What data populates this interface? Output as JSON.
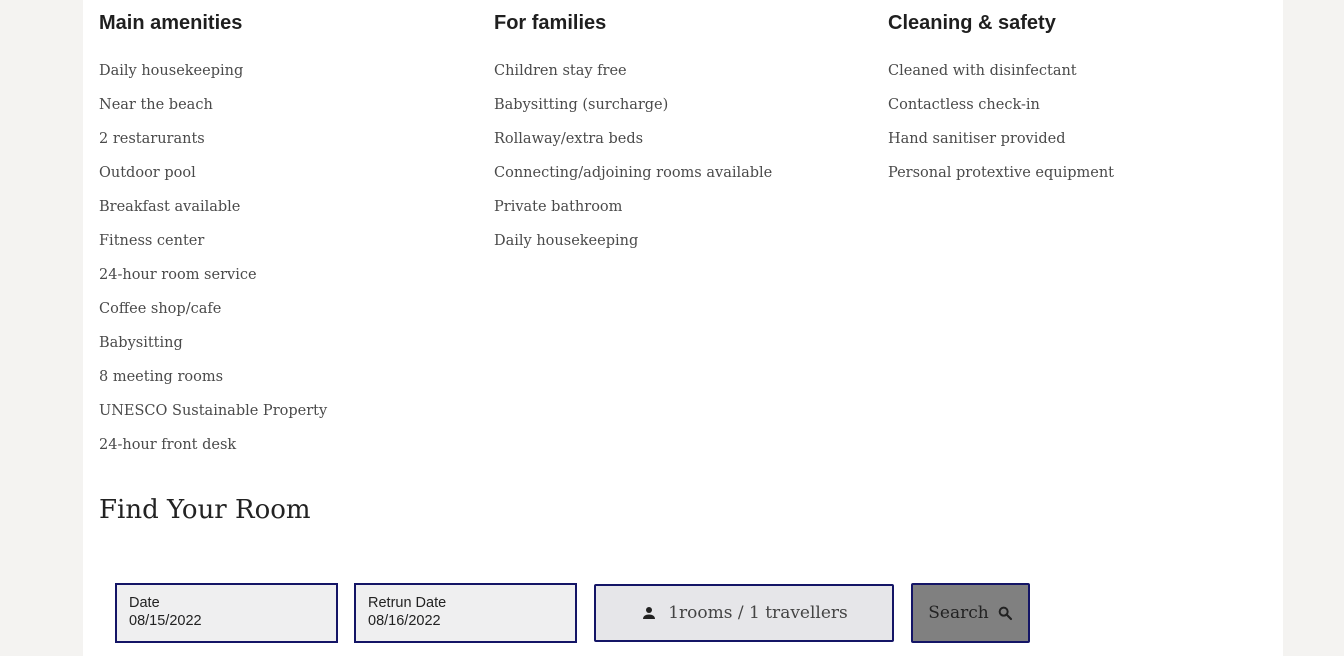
{
  "amenities": {
    "columns": [
      {
        "title": "Main amenities",
        "items": [
          "Daily housekeeping",
          "Near the beach",
          "2 restarurants",
          "Outdoor pool",
          "Breakfast available",
          "Fitness center",
          "24-hour room service",
          "Coffee shop/cafe",
          "Babysitting",
          "8 meeting rooms",
          "UNESCO Sustainable Property",
          "24-hour front desk"
        ]
      },
      {
        "title": "For families",
        "items": [
          "Children stay free",
          "Babysitting (surcharge)",
          "Rollaway/extra beds",
          "Connecting/adjoining rooms available",
          "Private bathroom",
          "Daily housekeeping"
        ]
      },
      {
        "title": "Cleaning & safety",
        "items": [
          "Cleaned with disinfectant",
          "Contactless check-in",
          "Hand sanitiser provided",
          "Personal protextive equipment"
        ]
      }
    ]
  },
  "find_room": {
    "title": "Find Your Room",
    "date": {
      "label": "Date",
      "value": "08/15/2022"
    },
    "return_date": {
      "label": "Retrun Date",
      "value": "08/16/2022"
    },
    "guests": {
      "text": "1rooms / 1 travellers",
      "icon": "person-icon"
    },
    "search": {
      "label": "Search",
      "icon": "search-icon"
    }
  },
  "colors": {
    "page_background": "#f4f3f1",
    "content_background": "#ffffff",
    "field_border": "#141566",
    "search_button": "#808080"
  }
}
